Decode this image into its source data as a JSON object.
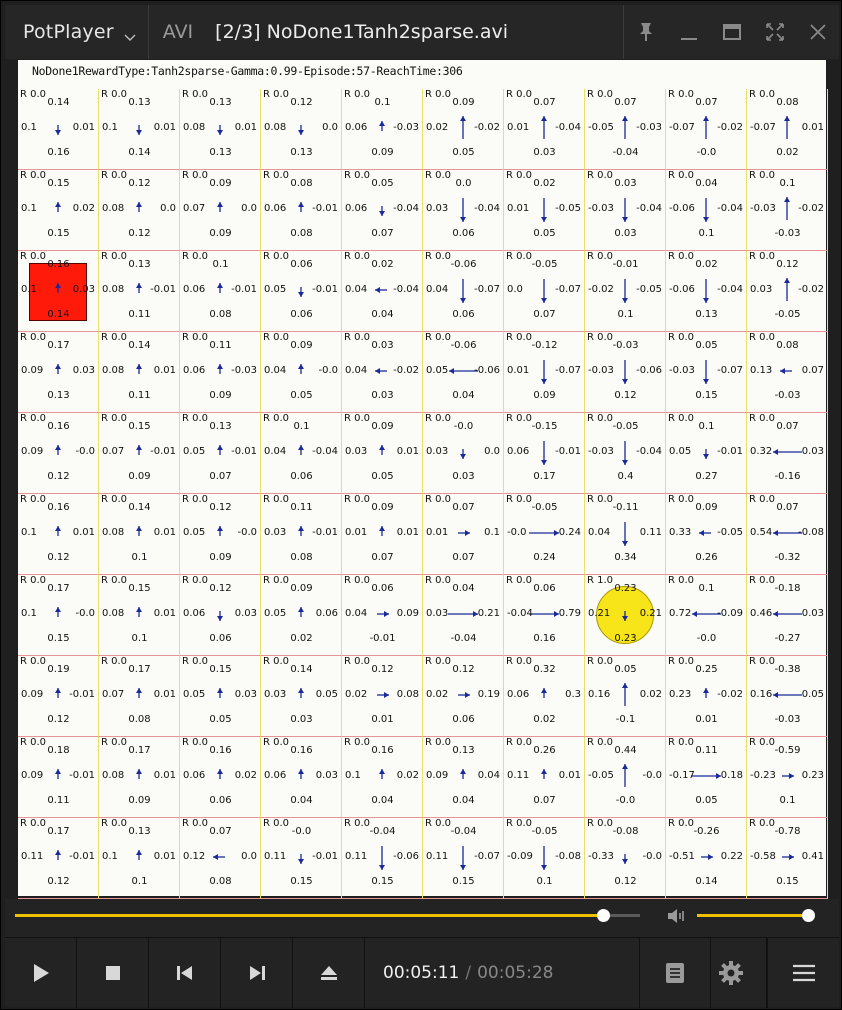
{
  "titlebar": {
    "app_name": "PotPlayer",
    "format": "AVI",
    "file_title": "[2/3] NoDone1Tanh2sparse.avi"
  },
  "video": {
    "caption": "NoDone1RewardType:Tanh2sparse-Gamma:0.99-Episode:57-ReachTime:306",
    "agent_cell": [
      2,
      0
    ],
    "goal_cell": [
      6,
      7
    ],
    "grid": [
      [
        [
          "R 0.0",
          "0.14",
          "0.1",
          "0.01",
          "0.16",
          "down"
        ],
        [
          "R 0.0",
          "0.13",
          "0.1",
          "0.01",
          "0.14",
          "down"
        ],
        [
          "R 0.0",
          "0.13",
          "0.08",
          "0.01",
          "0.13",
          "down"
        ],
        [
          "R 0.0",
          "0.12",
          "0.08",
          "0.0",
          "0.13",
          "down"
        ],
        [
          "R 0.0",
          "0.1",
          "0.06",
          "-0.03",
          "0.09",
          "up"
        ],
        [
          "R 0.0",
          "0.09",
          "0.02",
          "-0.02",
          "0.05",
          "upL"
        ],
        [
          "R 0.0",
          "0.07",
          "0.01",
          "-0.04",
          "0.03",
          "upL"
        ],
        [
          "R 0.0",
          "0.07",
          "-0.05",
          "-0.03",
          "-0.04",
          "upL"
        ],
        [
          "R 0.0",
          "0.07",
          "-0.07",
          "-0.02",
          "-0.0",
          "upL"
        ],
        [
          "R 0.0",
          "0.08",
          "-0.07",
          "0.01",
          "0.02",
          "upL"
        ]
      ],
      [
        [
          "R 0.0",
          "0.15",
          "0.1",
          "0.02",
          "0.15",
          "up"
        ],
        [
          "R 0.0",
          "0.12",
          "0.08",
          "0.0",
          "0.12",
          "up"
        ],
        [
          "R 0.0",
          "0.09",
          "0.07",
          "0.0",
          "0.09",
          "up"
        ],
        [
          "R 0.0",
          "0.08",
          "0.06",
          "-0.01",
          "0.08",
          "up"
        ],
        [
          "R 0.0",
          "0.05",
          "0.06",
          "-0.04",
          "0.07",
          "down"
        ],
        [
          "R 0.0",
          "0.0",
          "0.03",
          "-0.04",
          "0.06",
          "downL"
        ],
        [
          "R 0.0",
          "0.02",
          "0.01",
          "-0.05",
          "0.05",
          "downL"
        ],
        [
          "R 0.0",
          "0.03",
          "-0.03",
          "-0.04",
          "0.03",
          "downL"
        ],
        [
          "R 0.0",
          "0.04",
          "-0.06",
          "-0.04",
          "0.1",
          "downL"
        ],
        [
          "R 0.0",
          "0.1",
          "-0.03",
          "-0.02",
          "-0.03",
          "upL"
        ]
      ],
      [
        [
          "R 0.0",
          "0.16",
          "0.1",
          "0.03",
          "0.14",
          "up"
        ],
        [
          "R 0.0",
          "0.13",
          "0.08",
          "-0.01",
          "0.11",
          "up"
        ],
        [
          "R 0.0",
          "0.1",
          "0.06",
          "-0.01",
          "0.08",
          "up"
        ],
        [
          "R 0.0",
          "0.06",
          "0.05",
          "-0.01",
          "0.06",
          "down"
        ],
        [
          "R 0.0",
          "0.02",
          "0.04",
          "-0.04",
          "0.04",
          "left"
        ],
        [
          "R 0.0",
          "-0.06",
          "0.04",
          "-0.07",
          "0.06",
          "downL"
        ],
        [
          "R 0.0",
          "-0.05",
          "0.0",
          "-0.07",
          "0.07",
          "downL"
        ],
        [
          "R 0.0",
          "-0.01",
          "-0.02",
          "-0.05",
          "0.1",
          "downL"
        ],
        [
          "R 0.0",
          "0.02",
          "-0.06",
          "-0.04",
          "0.13",
          "downL"
        ],
        [
          "R 0.0",
          "0.12",
          "0.03",
          "-0.02",
          "-0.05",
          "upL"
        ]
      ],
      [
        [
          "R 0.0",
          "0.17",
          "0.09",
          "0.03",
          "0.13",
          "up"
        ],
        [
          "R 0.0",
          "0.14",
          "0.08",
          "0.01",
          "0.11",
          "up"
        ],
        [
          "R 0.0",
          "0.11",
          "0.06",
          "-0.03",
          "0.09",
          "up"
        ],
        [
          "R 0.0",
          "0.09",
          "0.04",
          "-0.0",
          "0.05",
          "up"
        ],
        [
          "R 0.0",
          "0.03",
          "0.04",
          "-0.02",
          "0.03",
          "left"
        ],
        [
          "R 0.0",
          "-0.06",
          "0.05",
          "-0.06",
          "0.04",
          "leftL"
        ],
        [
          "R 0.0",
          "-0.12",
          "0.01",
          "-0.07",
          "0.09",
          "downL"
        ],
        [
          "R 0.0",
          "-0.03",
          "-0.03",
          "-0.06",
          "0.12",
          "downL"
        ],
        [
          "R 0.0",
          "0.05",
          "-0.03",
          "-0.07",
          "0.15",
          "downL"
        ],
        [
          "R 0.0",
          "0.08",
          "0.13",
          "0.07",
          "-0.03",
          "left"
        ]
      ],
      [
        [
          "R 0.0",
          "0.16",
          "0.09",
          "-0.0",
          "0.12",
          "up"
        ],
        [
          "R 0.0",
          "0.15",
          "0.07",
          "-0.01",
          "0.09",
          "up"
        ],
        [
          "R 0.0",
          "0.13",
          "0.05",
          "-0.01",
          "0.07",
          "up"
        ],
        [
          "R 0.0",
          "0.1",
          "0.04",
          "-0.04",
          "0.06",
          "up"
        ],
        [
          "R 0.0",
          "0.09",
          "0.03",
          "0.01",
          "0.05",
          "up"
        ],
        [
          "R 0.0",
          "-0.0",
          "0.03",
          "0.0",
          "0.03",
          "down"
        ],
        [
          "R 0.0",
          "-0.15",
          "0.06",
          "-0.01",
          "0.17",
          "downL"
        ],
        [
          "R 0.0",
          "-0.05",
          "-0.03",
          "-0.04",
          "0.4",
          "downL"
        ],
        [
          "R 0.0",
          "0.1",
          "0.05",
          "-0.01",
          "0.27",
          "down"
        ],
        [
          "R 0.0",
          "0.07",
          "0.32",
          "0.03",
          "-0.16",
          "leftL"
        ]
      ],
      [
        [
          "R 0.0",
          "0.16",
          "0.1",
          "0.01",
          "0.12",
          "up"
        ],
        [
          "R 0.0",
          "0.14",
          "0.08",
          "0.01",
          "0.1",
          "up"
        ],
        [
          "R 0.0",
          "0.12",
          "0.05",
          "-0.0",
          "0.09",
          "up"
        ],
        [
          "R 0.0",
          "0.11",
          "0.03",
          "-0.01",
          "0.08",
          "up"
        ],
        [
          "R 0.0",
          "0.09",
          "0.01",
          "0.01",
          "0.07",
          "up"
        ],
        [
          "R 0.0",
          "0.07",
          "0.01",
          "0.1",
          "0.07",
          "right"
        ],
        [
          "R 0.0",
          "-0.05",
          "-0.0",
          "0.24",
          "0.24",
          "rightL"
        ],
        [
          "R 0.0",
          "-0.11",
          "0.04",
          "0.11",
          "0.34",
          "downL"
        ],
        [
          "R 0.0",
          "0.09",
          "0.33",
          "-0.05",
          "0.26",
          "left"
        ],
        [
          "R 0.0",
          "0.07",
          "0.54",
          "-0.08",
          "-0.32",
          "leftL"
        ]
      ],
      [
        [
          "R 0.0",
          "0.17",
          "0.1",
          "-0.0",
          "0.15",
          "up"
        ],
        [
          "R 0.0",
          "0.15",
          "0.08",
          "0.01",
          "0.1",
          "up"
        ],
        [
          "R 0.0",
          "0.12",
          "0.06",
          "0.03",
          "0.06",
          "down"
        ],
        [
          "R 0.0",
          "0.09",
          "0.05",
          "0.06",
          "0.02",
          "up"
        ],
        [
          "R 0.0",
          "0.06",
          "0.04",
          "0.09",
          "-0.01",
          "right"
        ],
        [
          "R 0.0",
          "0.04",
          "0.03",
          "0.21",
          "-0.04",
          "rightL"
        ],
        [
          "R 0.0",
          "0.06",
          "-0.04",
          "0.79",
          "0.16",
          "rightL"
        ],
        [
          "R 1.0",
          "0.23",
          "0.21",
          "0.21",
          "0.23",
          "down"
        ],
        [
          "R 0.0",
          "0.1",
          "0.72",
          "-0.09",
          "-0.0",
          "leftL"
        ],
        [
          "R 0.0",
          "-0.18",
          "0.46",
          "0.03",
          "-0.27",
          "leftL"
        ]
      ],
      [
        [
          "R 0.0",
          "0.19",
          "0.09",
          "-0.01",
          "0.12",
          "up"
        ],
        [
          "R 0.0",
          "0.17",
          "0.07",
          "0.01",
          "0.08",
          "up"
        ],
        [
          "R 0.0",
          "0.15",
          "0.05",
          "0.03",
          "0.05",
          "up"
        ],
        [
          "R 0.0",
          "0.14",
          "0.03",
          "0.05",
          "0.03",
          "up"
        ],
        [
          "R 0.0",
          "0.12",
          "0.02",
          "0.08",
          "0.01",
          "right"
        ],
        [
          "R 0.0",
          "0.12",
          "0.02",
          "0.19",
          "0.06",
          "right"
        ],
        [
          "R 0.0",
          "0.32",
          "0.06",
          "0.3",
          "0.02",
          "up"
        ],
        [
          "R 0.0",
          "0.05",
          "0.16",
          "0.02",
          "-0.1",
          "upL"
        ],
        [
          "R 0.0",
          "0.25",
          "0.23",
          "-0.02",
          "0.01",
          "up"
        ],
        [
          "R 0.0",
          "-0.38",
          "0.16",
          "0.05",
          "-0.03",
          "leftL"
        ]
      ],
      [
        [
          "R 0.0",
          "0.18",
          "0.09",
          "-0.01",
          "0.11",
          "up"
        ],
        [
          "R 0.0",
          "0.17",
          "0.08",
          "0.01",
          "0.09",
          "up"
        ],
        [
          "R 0.0",
          "0.16",
          "0.06",
          "0.02",
          "0.06",
          "up"
        ],
        [
          "R 0.0",
          "0.16",
          "0.06",
          "0.03",
          "0.04",
          "up"
        ],
        [
          "R 0.0",
          "0.16",
          "0.1",
          "0.02",
          "0.04",
          "up"
        ],
        [
          "R 0.0",
          "0.13",
          "0.09",
          "0.04",
          "0.04",
          "up"
        ],
        [
          "R 0.0",
          "0.26",
          "0.11",
          "0.01",
          "0.07",
          "up"
        ],
        [
          "R 0.0",
          "0.44",
          "-0.05",
          "-0.0",
          "-0.0",
          "upL"
        ],
        [
          "R 0.0",
          "0.11",
          "-0.17",
          "0.18",
          "0.05",
          "rightL"
        ],
        [
          "R 0.0",
          "-0.59",
          "-0.23",
          "0.23",
          "0.1",
          "right"
        ]
      ],
      [
        [
          "R 0.0",
          "0.17",
          "0.11",
          "-0.01",
          "0.12",
          "up"
        ],
        [
          "R 0.0",
          "0.13",
          "0.1",
          "0.01",
          "0.1",
          "up"
        ],
        [
          "R 0.0",
          "0.07",
          "0.12",
          "0.0",
          "0.08",
          "left"
        ],
        [
          "R 0.0",
          "-0.0",
          "0.11",
          "-0.01",
          "0.15",
          "down"
        ],
        [
          "R 0.0",
          "-0.04",
          "0.11",
          "-0.06",
          "0.15",
          "downL"
        ],
        [
          "R 0.0",
          "-0.04",
          "0.11",
          "-0.07",
          "0.15",
          "downL"
        ],
        [
          "R 0.0",
          "-0.05",
          "-0.09",
          "-0.08",
          "0.1",
          "downL"
        ],
        [
          "R 0.0",
          "-0.08",
          "-0.33",
          "-0.0",
          "0.12",
          "down"
        ],
        [
          "R 0.0",
          "-0.26",
          "-0.51",
          "0.22",
          "0.14",
          "right"
        ],
        [
          "R 0.0",
          "-0.78",
          "-0.58",
          "0.41",
          "0.15",
          "right"
        ]
      ]
    ]
  },
  "player": {
    "seek_fraction": 0.94,
    "volume_fraction": 0.99,
    "current_time": "00:05:11",
    "separator": "/",
    "total_time": "00:05:28",
    "accent_color": "#f2c200",
    "icons": [
      "play-icon",
      "stop-icon",
      "previous-icon",
      "next-icon",
      "eject-icon",
      "playlist-icon",
      "settings-icon",
      "menu-icon",
      "volume-icon",
      "pin-icon",
      "minimize-icon",
      "maximize-icon",
      "fullscreen-icon",
      "close-icon"
    ]
  }
}
